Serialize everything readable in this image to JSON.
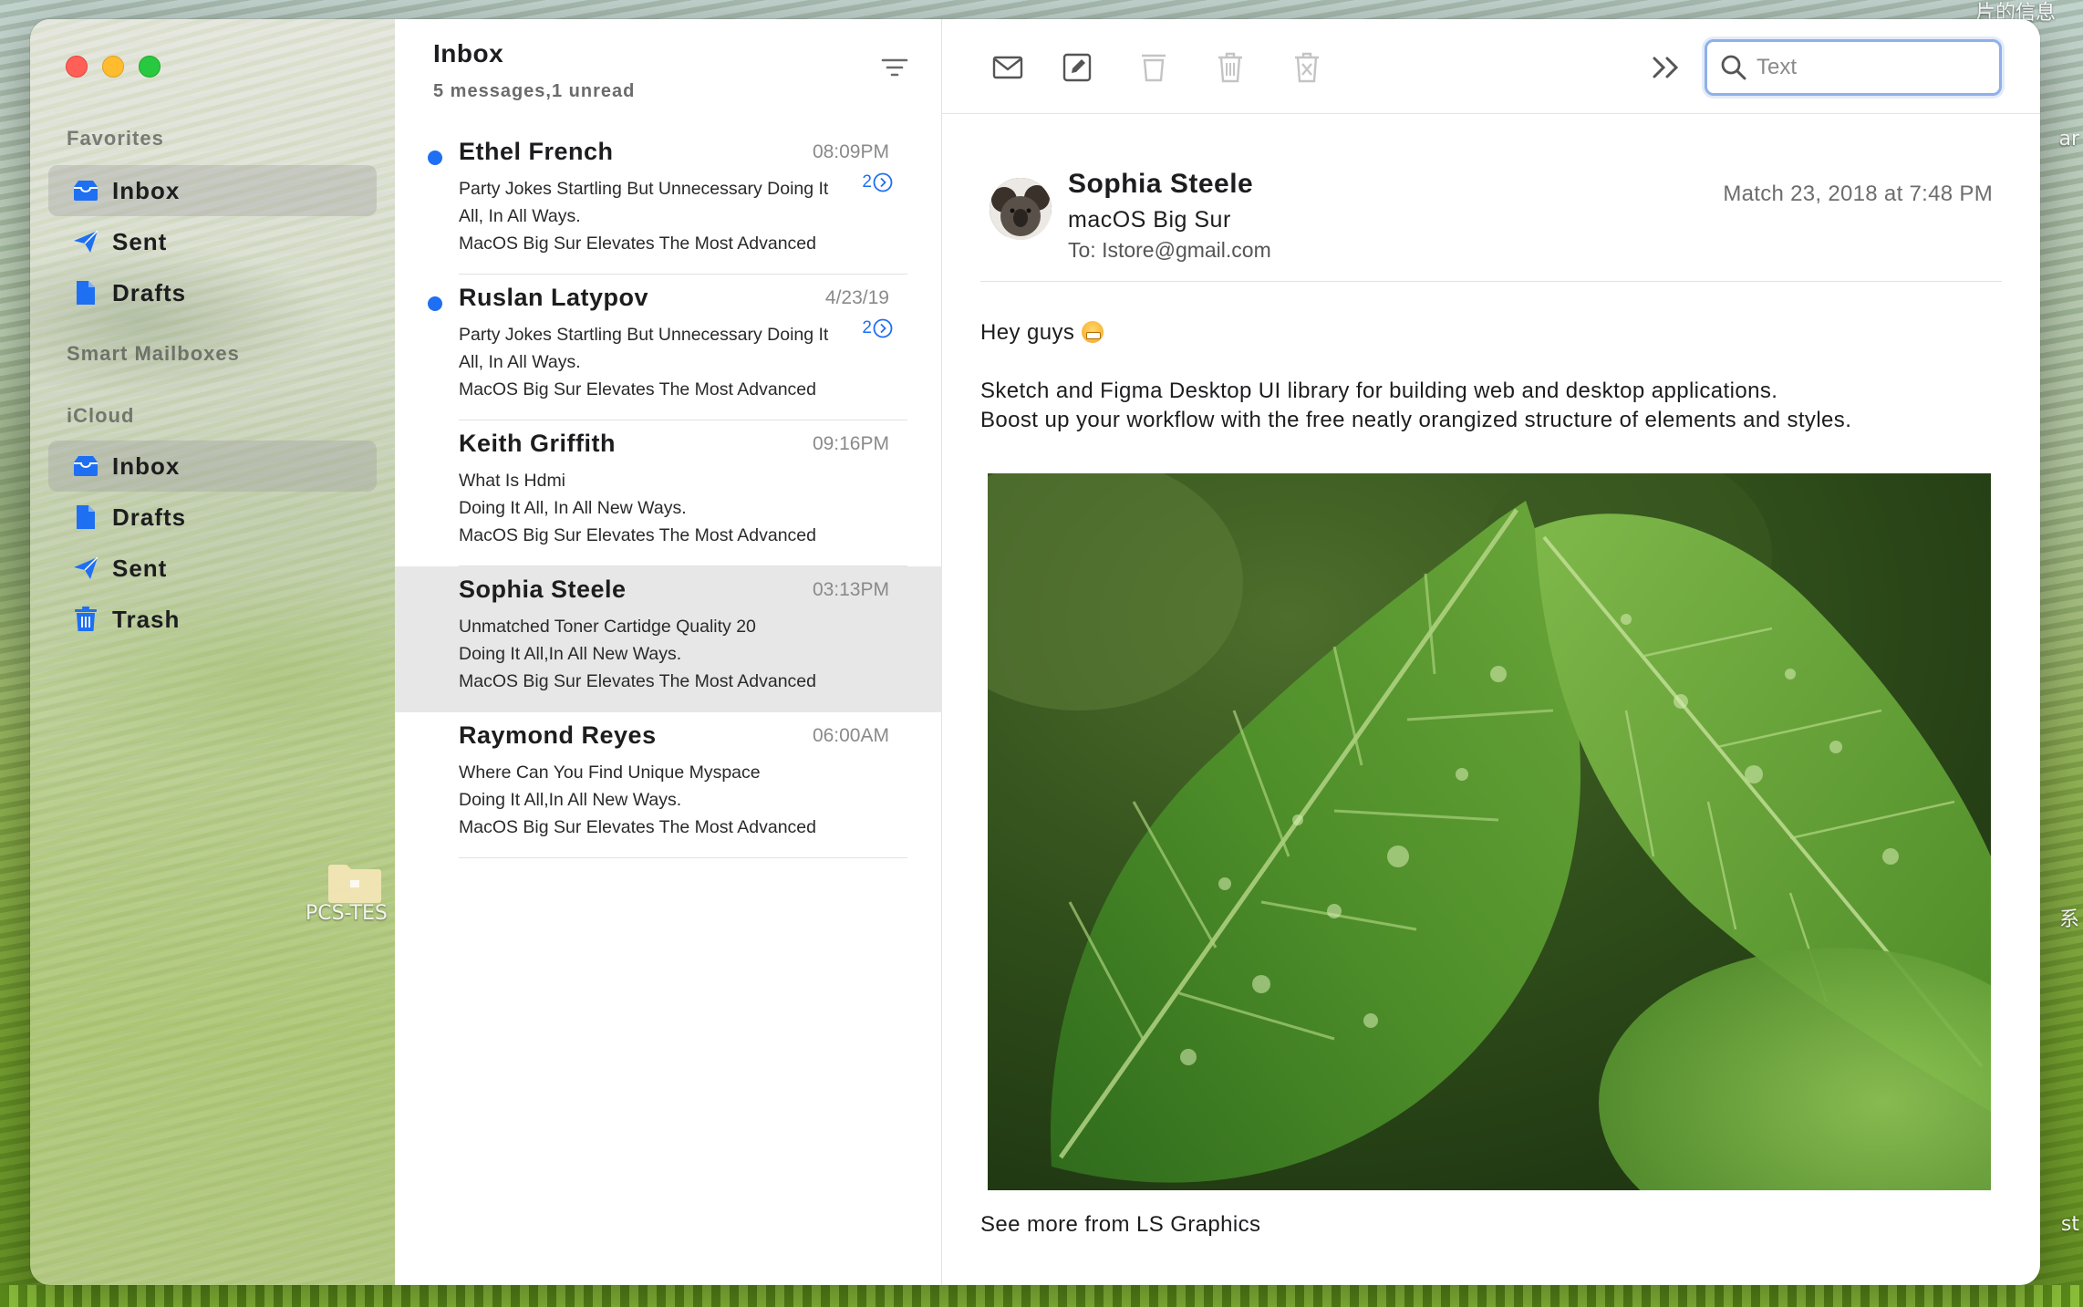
{
  "desktop": {
    "folder_label": "PCS-TES",
    "corner_label": "片的信息",
    "edge_label_1": "系",
    "edge_label_2": "st",
    "edge_label_3": "ar"
  },
  "sidebar": {
    "favorites_title": "Favorites",
    "favorites": [
      {
        "label": "Inbox",
        "icon": "inbox-icon"
      },
      {
        "label": "Sent",
        "icon": "paperplane-icon"
      },
      {
        "label": "Drafts",
        "icon": "document-icon"
      }
    ],
    "smart_title": "Smart Mailboxes",
    "icloud_title": "iCloud",
    "icloud": [
      {
        "label": "Inbox",
        "icon": "inbox-icon"
      },
      {
        "label": "Drafts",
        "icon": "document-icon"
      },
      {
        "label": "Sent",
        "icon": "paperplane-icon"
      },
      {
        "label": "Trash",
        "icon": "trash-icon"
      }
    ]
  },
  "list": {
    "title": "Inbox",
    "subtitle": "5 messages,1 unread",
    "messages": [
      {
        "sender": "Ethel French",
        "time": "08:09PM",
        "unread": true,
        "badge": "2",
        "line1": "Party Jokes Startling But Unnecessary Doing It",
        "line2": "All, In All Ways.",
        "line3": "MacOS Big Sur Elevates The Most Advanced"
      },
      {
        "sender": "Ruslan Latypov",
        "time": "4/23/19",
        "unread": true,
        "badge": "2",
        "line1": "Party Jokes Startling But Unnecessary Doing It",
        "line2": "All, In All Ways.",
        "line3": "MacOS Big Sur Elevates The Most Advanced"
      },
      {
        "sender": "Keith Griffith",
        "time": "09:16PM",
        "unread": false,
        "line1": "What Is Hdmi",
        "line2": "Doing It All, In All New Ways.",
        "line3": "MacOS Big Sur Elevates The Most Advanced"
      },
      {
        "sender": "Sophia Steele",
        "time": "03:13PM",
        "unread": false,
        "selected": true,
        "line1": "Unmatched Toner Cartidge Quality 20",
        "line2": "Doing It All,In All New Ways.",
        "line3": "MacOS Big Sur Elevates The Most Advanced"
      },
      {
        "sender": "Raymond Reyes",
        "time": "06:00AM",
        "unread": false,
        "line1": "Where Can You Find Unique Myspace",
        "line2": "Doing It All,In All New Ways.",
        "line3": "MacOS Big Sur Elevates The Most Advanced"
      }
    ]
  },
  "toolbar": {
    "search_placeholder": "Text"
  },
  "mail": {
    "sender": "Sophia Steele",
    "org": "macOS Big Sur",
    "to": "To: Istore@gmail.com",
    "date": "Match 23, 2018 at 7:48 PM",
    "greeting": "Hey guys",
    "para1": "Sketch and Figma Desktop UI library for building web and desktop applications.",
    "para2": "Boost up your workflow with the free neatly orangized structure of elements and styles.",
    "footer": "See more from LS Graphics"
  },
  "colors": {
    "accent": "#1e6ff2",
    "unread_dot": "#1e6ff2",
    "selected_row": "#e7e7e7",
    "close": "#ff5f57",
    "minimize": "#febc2e",
    "maximize": "#28c840"
  }
}
